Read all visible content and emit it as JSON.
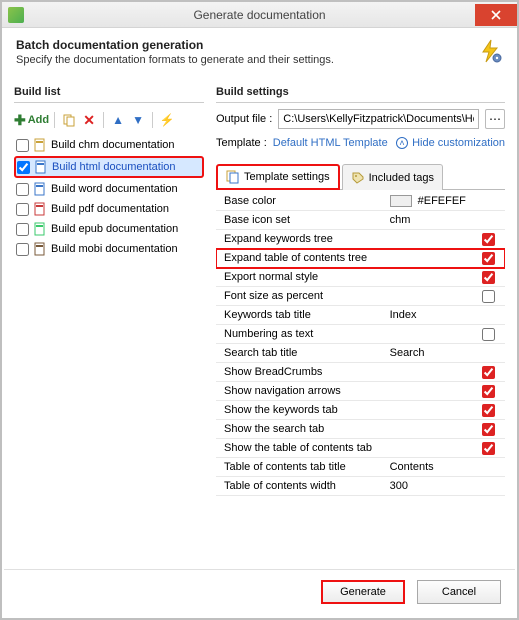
{
  "window": {
    "title": "Generate documentation"
  },
  "header": {
    "title": "Batch documentation generation",
    "subtitle": "Specify the documentation formats to generate and their settings."
  },
  "buildList": {
    "title": "Build list",
    "addLabel": "Add",
    "items": [
      {
        "label": "Build chm documentation",
        "checked": false,
        "selected": false,
        "iconColor": "#c9a23a"
      },
      {
        "label": "Build html documentation",
        "checked": true,
        "selected": true,
        "iconColor": "#3a76c9"
      },
      {
        "label": "Build word documentation",
        "checked": false,
        "selected": false,
        "iconColor": "#3a76c9"
      },
      {
        "label": "Build pdf documentation",
        "checked": false,
        "selected": false,
        "iconColor": "#c93a3a"
      },
      {
        "label": "Build epub documentation",
        "checked": false,
        "selected": false,
        "iconColor": "#3ac96b"
      },
      {
        "label": "Build mobi documentation",
        "checked": false,
        "selected": false,
        "iconColor": "#7a5a3a"
      }
    ]
  },
  "buildSettings": {
    "title": "Build settings",
    "outputFileLabel": "Output file :",
    "outputFileValue": "C:\\Users\\KellyFitzpatrick\\Documents\\HelpNDoc",
    "templateLabel": "Template :",
    "templateValue": "Default HTML Template",
    "hideCustomization": "Hide customization",
    "tabs": {
      "templateSettings": "Template settings",
      "includedTags": "Included tags"
    },
    "properties": [
      {
        "key": "Base color",
        "type": "color",
        "value": "#EFEFEF"
      },
      {
        "key": "Base icon set",
        "type": "text",
        "value": "chm"
      },
      {
        "key": "Expand keywords tree",
        "type": "bool",
        "value": true
      },
      {
        "key": "Expand table of contents tree",
        "type": "bool",
        "value": true,
        "highlight": true
      },
      {
        "key": "Export normal style",
        "type": "bool",
        "value": true
      },
      {
        "key": "Font size as percent",
        "type": "bool",
        "value": false
      },
      {
        "key": "Keywords tab title",
        "type": "text",
        "value": "Index"
      },
      {
        "key": "Numbering as text",
        "type": "bool",
        "value": false
      },
      {
        "key": "Search tab title",
        "type": "text",
        "value": "Search"
      },
      {
        "key": "Show BreadCrumbs",
        "type": "bool",
        "value": true
      },
      {
        "key": "Show navigation arrows",
        "type": "bool",
        "value": true
      },
      {
        "key": "Show the keywords tab",
        "type": "bool",
        "value": true
      },
      {
        "key": "Show the search tab",
        "type": "bool",
        "value": true
      },
      {
        "key": "Show the table of contents tab",
        "type": "bool",
        "value": true
      },
      {
        "key": "Table of contents tab title",
        "type": "text",
        "value": "Contents"
      },
      {
        "key": "Table of contents width",
        "type": "text",
        "value": "300"
      }
    ]
  },
  "footer": {
    "generate": "Generate",
    "cancel": "Cancel"
  }
}
